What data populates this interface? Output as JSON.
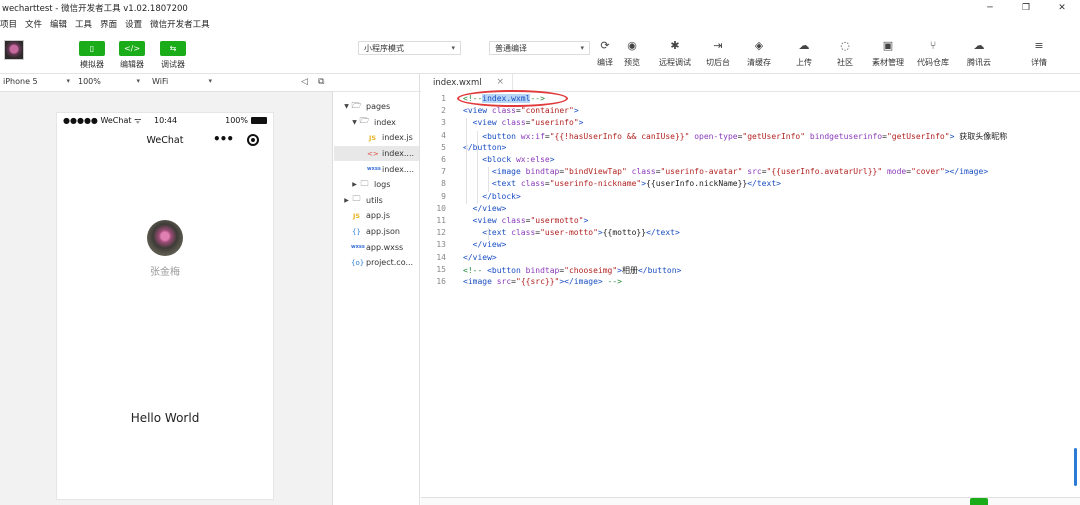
{
  "window": {
    "title": "wecharttest - 微信开发者工具 v1.02.1807200",
    "controls": [
      "─",
      "❐",
      "✕"
    ]
  },
  "menu": [
    "项目",
    "文件",
    "编辑",
    "工具",
    "界面",
    "设置",
    "微信开发者工具"
  ],
  "toolbar": {
    "mode_buttons": [
      {
        "label": "模拟器",
        "icon": "▯"
      },
      {
        "label": "编辑器",
        "icon": "</>"
      },
      {
        "label": "调试器",
        "icon": "⇆"
      }
    ],
    "mode_select": "小程序模式",
    "compile_select": "普通编译",
    "tools": [
      {
        "label": "编译",
        "icon": "⟳"
      },
      {
        "label": "预览",
        "icon": "◉"
      },
      {
        "label": "远程调试",
        "icon": "✱"
      },
      {
        "label": "切后台",
        "icon": "⇥"
      },
      {
        "label": "清缓存",
        "icon": "◈"
      },
      {
        "label": "上传",
        "icon": "☁"
      },
      {
        "label": "社区",
        "icon": "◌"
      },
      {
        "label": "素材管理",
        "icon": "▣"
      },
      {
        "label": "代码仓库",
        "icon": "⑂"
      },
      {
        "label": "腾讯云",
        "icon": "☁"
      },
      {
        "label": "详情",
        "icon": "≡"
      }
    ]
  },
  "subbar": {
    "device": "iPhone 5",
    "zoom": "100%",
    "network": "WiFi"
  },
  "phone": {
    "status_left": "●●●●● WeChat",
    "wifi_glyph": "ᯤ",
    "status_time": "10:44",
    "status_battery": "100%",
    "nav_title": "WeChat",
    "nav_dots": "•••",
    "nickname": "张金梅",
    "motto": "Hello World"
  },
  "file_tree": [
    {
      "name": "pages",
      "type": "folder",
      "depth": 0,
      "arrow": "▼",
      "icon": "🗁"
    },
    {
      "name": "index",
      "type": "folder",
      "depth": 1,
      "arrow": "▼",
      "icon": "🗁"
    },
    {
      "name": "index.js",
      "type": "js",
      "depth": 2,
      "arrow": "",
      "icon": "JS"
    },
    {
      "name": "index....",
      "type": "wxml",
      "depth": 2,
      "arrow": "",
      "icon": "<>",
      "selected": true
    },
    {
      "name": "index....",
      "type": "wxss",
      "depth": 2,
      "arrow": "",
      "icon": "wxss"
    },
    {
      "name": "logs",
      "type": "folder",
      "depth": 1,
      "arrow": "▶",
      "icon": "🗀"
    },
    {
      "name": "utils",
      "type": "folder",
      "depth": 0,
      "arrow": "▶",
      "icon": "🗀"
    },
    {
      "name": "app.js",
      "type": "js",
      "depth": 0,
      "arrow": "",
      "icon": "JS"
    },
    {
      "name": "app.json",
      "type": "json",
      "depth": 0,
      "arrow": "",
      "icon": "{}"
    },
    {
      "name": "app.wxss",
      "type": "wxss",
      "depth": 0,
      "arrow": "",
      "icon": "wxss"
    },
    {
      "name": "project.co...",
      "type": "json",
      "depth": 0,
      "arrow": "",
      "icon": "{o}"
    }
  ],
  "editor": {
    "tab": "index.wxml",
    "tab_close": "×",
    "lines": [
      [
        [
          "cmt",
          "<!--"
        ],
        [
          "sel",
          "index.wxml"
        ],
        [
          "cmt",
          "-->"
        ]
      ],
      [
        [
          "tag",
          "<view "
        ],
        [
          "attr",
          "class"
        ],
        [
          "txt",
          "="
        ],
        [
          "str",
          "\"container\""
        ],
        [
          "tag",
          ">"
        ]
      ],
      [
        [
          "txt",
          "  "
        ],
        [
          "tag",
          "<view "
        ],
        [
          "attr",
          "class"
        ],
        [
          "txt",
          "="
        ],
        [
          "str",
          "\"userinfo\""
        ],
        [
          "tag",
          ">"
        ]
      ],
      [
        [
          "txt",
          "    "
        ],
        [
          "tag",
          "<button "
        ],
        [
          "attr",
          "wx:if"
        ],
        [
          "txt",
          "="
        ],
        [
          "str",
          "\"{{!hasUserInfo && canIUse}}\""
        ],
        [
          "txt",
          " "
        ],
        [
          "attr",
          "open-type"
        ],
        [
          "txt",
          "="
        ],
        [
          "str",
          "\"getUserInfo\""
        ],
        [
          "txt",
          " "
        ],
        [
          "attr",
          "bindgetuserinfo"
        ],
        [
          "txt",
          "="
        ],
        [
          "str",
          "\"getUserInfo\""
        ],
        [
          "tag",
          ">"
        ],
        [
          "txt",
          " 获取头像昵称"
        ]
      ],
      [
        [
          "tag",
          "</button>"
        ]
      ],
      [
        [
          "txt",
          "    "
        ],
        [
          "tag",
          "<block "
        ],
        [
          "attr",
          "wx:else"
        ],
        [
          "tag",
          ">"
        ]
      ],
      [
        [
          "txt",
          "      "
        ],
        [
          "tag",
          "<image "
        ],
        [
          "attr",
          "bindtap"
        ],
        [
          "txt",
          "="
        ],
        [
          "str",
          "\"bindViewTap\""
        ],
        [
          "txt",
          " "
        ],
        [
          "attr",
          "class"
        ],
        [
          "txt",
          "="
        ],
        [
          "str",
          "\"userinfo-avatar\""
        ],
        [
          "txt",
          " "
        ],
        [
          "attr",
          "src"
        ],
        [
          "txt",
          "="
        ],
        [
          "str",
          "\"{{userInfo.avatarUrl}}\""
        ],
        [
          "txt",
          " "
        ],
        [
          "attr",
          "mode"
        ],
        [
          "txt",
          "="
        ],
        [
          "str",
          "\"cover\""
        ],
        [
          "tag",
          "></image>"
        ]
      ],
      [
        [
          "txt",
          "      "
        ],
        [
          "tag",
          "<text "
        ],
        [
          "attr",
          "class"
        ],
        [
          "txt",
          "="
        ],
        [
          "str",
          "\"userinfo-nickname\""
        ],
        [
          "tag",
          ">"
        ],
        [
          "txt",
          "{{userInfo.nickName}}"
        ],
        [
          "tag",
          "</text>"
        ]
      ],
      [
        [
          "txt",
          "    "
        ],
        [
          "tag",
          "</block>"
        ]
      ],
      [
        [
          "txt",
          "  "
        ],
        [
          "tag",
          "</view>"
        ]
      ],
      [
        [
          "txt",
          "  "
        ],
        [
          "tag",
          "<view "
        ],
        [
          "attr",
          "class"
        ],
        [
          "txt",
          "="
        ],
        [
          "str",
          "\"usermotto\""
        ],
        [
          "tag",
          ">"
        ]
      ],
      [
        [
          "txt",
          "    "
        ],
        [
          "tag",
          "<text "
        ],
        [
          "attr",
          "class"
        ],
        [
          "txt",
          "="
        ],
        [
          "str",
          "\"user-motto\""
        ],
        [
          "tag",
          ">"
        ],
        [
          "txt",
          "{{motto}}"
        ],
        [
          "tag",
          "</text>"
        ]
      ],
      [
        [
          "txt",
          "  "
        ],
        [
          "tag",
          "</view>"
        ]
      ],
      [
        [
          "tag",
          "</view>"
        ]
      ],
      [
        [
          "cmt",
          "<!-- "
        ],
        [
          "tag",
          "<button "
        ],
        [
          "attr",
          "bindtap"
        ],
        [
          "txt",
          "="
        ],
        [
          "str",
          "\"chooseimg\""
        ],
        [
          "tag",
          ">"
        ],
        [
          "txt",
          "相册"
        ],
        [
          "tag",
          "</button>"
        ]
      ],
      [
        [
          "tag",
          "<image "
        ],
        [
          "attr",
          "src"
        ],
        [
          "txt",
          "="
        ],
        [
          "str",
          "\"{{src}}\""
        ],
        [
          "tag",
          "></image>"
        ],
        [
          "cmt",
          " -->"
        ]
      ]
    ]
  }
}
